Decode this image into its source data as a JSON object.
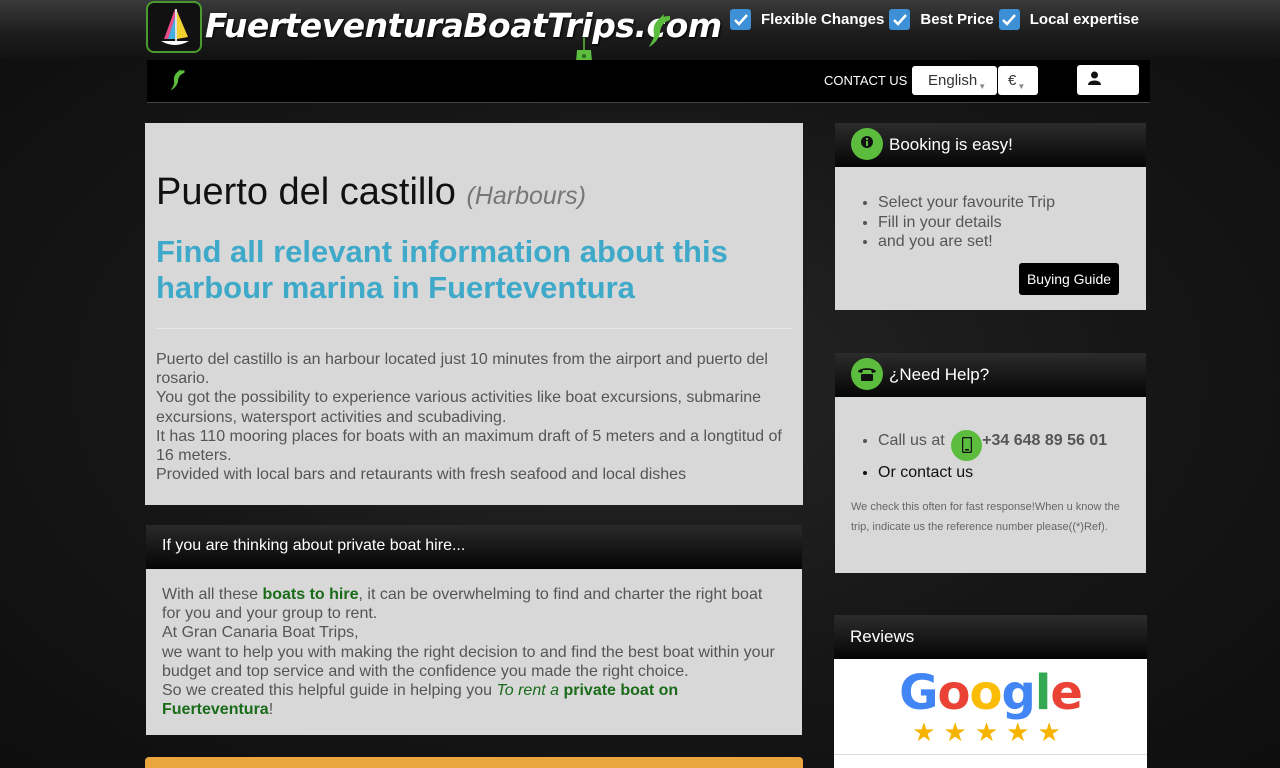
{
  "header": {
    "logo_text": "FuerteventuraBoatTrips.com",
    "features": [
      {
        "label": "Flexible Changes"
      },
      {
        "label": "Best Price"
      },
      {
        "label": "Local expertise"
      }
    ]
  },
  "nav": {
    "contact_label": "CONTACT US",
    "language": "English",
    "currency": "€"
  },
  "main": {
    "title": "Puerto del castillo",
    "category": "(Harbours)",
    "headline": "Find all relevant information about this harbour marina in Fuerteventura",
    "description": [
      "Puerto del castillo is an harbour located just 10 minutes from the airport and puerto del rosario.",
      "You got the possibility to experience various activities like boat excursions, submarine excursions, watersport activities and scubadiving.",
      "It has 110 mooring places for boats with an maximum draft of 5 meters and a longtitud of 16 meters.",
      "Provided with local bars and retaurants with fresh seafood and local dishes"
    ]
  },
  "hire": {
    "title": "If you are thinking about private boat hire...",
    "p1_a": "With all these ",
    "p1_link": "boats to hire",
    "p1_b": ", it can be overwhelming to find and charter the right boat for you and your group to rent.",
    "p2": "At Gran Canaria Boat Trips,",
    "p3": "we want to help you with making the right decision to and find the best boat within your budget and top service and with the confidence you made the right choice.",
    "p4_a": "So we created this helpful guide in helping you ",
    "p4_italic": "To rent a ",
    "p4_link": "private boat on Fuerteventura",
    "p4_end": "!"
  },
  "booking": {
    "title": "Booking is easy!",
    "steps": [
      "Select your favourite Trip",
      "Fill in your details",
      "and you are set!"
    ],
    "button_label": "Buying Guide"
  },
  "help": {
    "title": "¿Need Help?",
    "call_label": "Call us at",
    "phone": "+34 648 89 56 01",
    "contact_label": "Or contact us",
    "note": "We check this often for fast response!When u know the trip, indicate us the reference number please((*)Ref)."
  },
  "reviews": {
    "title": "Reviews",
    "brand": "Google",
    "stars": "★★★★★"
  },
  "colors": {
    "accent_green": "#5cbc3e",
    "headline_blue": "#3fa9c9",
    "check_blue": "#3d8fd6",
    "link_green": "#1a6b1a",
    "orange": "#e9a53e"
  }
}
